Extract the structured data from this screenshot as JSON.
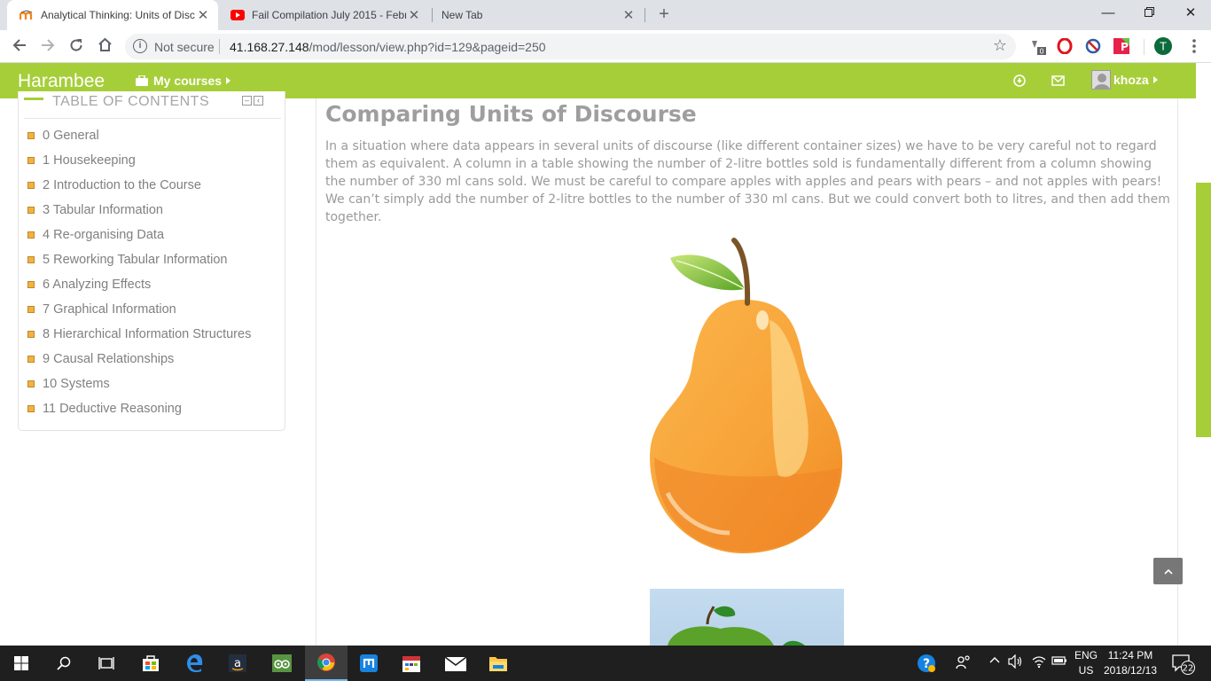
{
  "browser": {
    "tabs": [
      {
        "title": "Analytical Thinking: Units of Disc",
        "active": true
      },
      {
        "title": "Fail Compilation July 2015 - Febr",
        "active": false
      },
      {
        "title": "New Tab",
        "active": false
      }
    ],
    "security_label": "Not secure",
    "url_host": "41.168.27.148",
    "url_path": "/mod/lesson/view.php?id=129&pageid=250",
    "profile_initial": "T",
    "extension_badge": "0"
  },
  "navbar": {
    "brand": "Harambee",
    "my_courses": "My courses",
    "user_name": "khoza",
    "color": "#a6ce39"
  },
  "toc": {
    "title": "TABLE OF CONTENTS",
    "items": [
      "0 General",
      "1 Housekeeping",
      "2 Introduction to the Course",
      "3 Tabular Information",
      "4 Re-organising Data",
      "5 Reworking Tabular Information",
      "6 Analyzing Effects",
      "7 Graphical Information",
      "8 Hierarchical Information Structures",
      "9 Causal Relationships",
      "10 Systems",
      "11 Deductive Reasoning"
    ]
  },
  "page": {
    "title": "Comparing Units of Discourse",
    "body": "In a situation where data appears in several units of discourse (like different container sizes) we have to be very careful not to regard them as equivalent. A column in a table showing the number of 2-litre bottles sold is fundamentally different from a column showing the number of 330 ml cans sold. We must be careful to compare apples with apples and pears with pears – and not apples with pears! We can’t simply add the number of 2-litre bottles to the number of 330 ml cans. But we could convert both to litres, and then add them together."
  },
  "taskbar": {
    "language": "ENG",
    "region": "US",
    "time": "11:24 PM",
    "date": "2018/12/13",
    "notifications": "22"
  }
}
